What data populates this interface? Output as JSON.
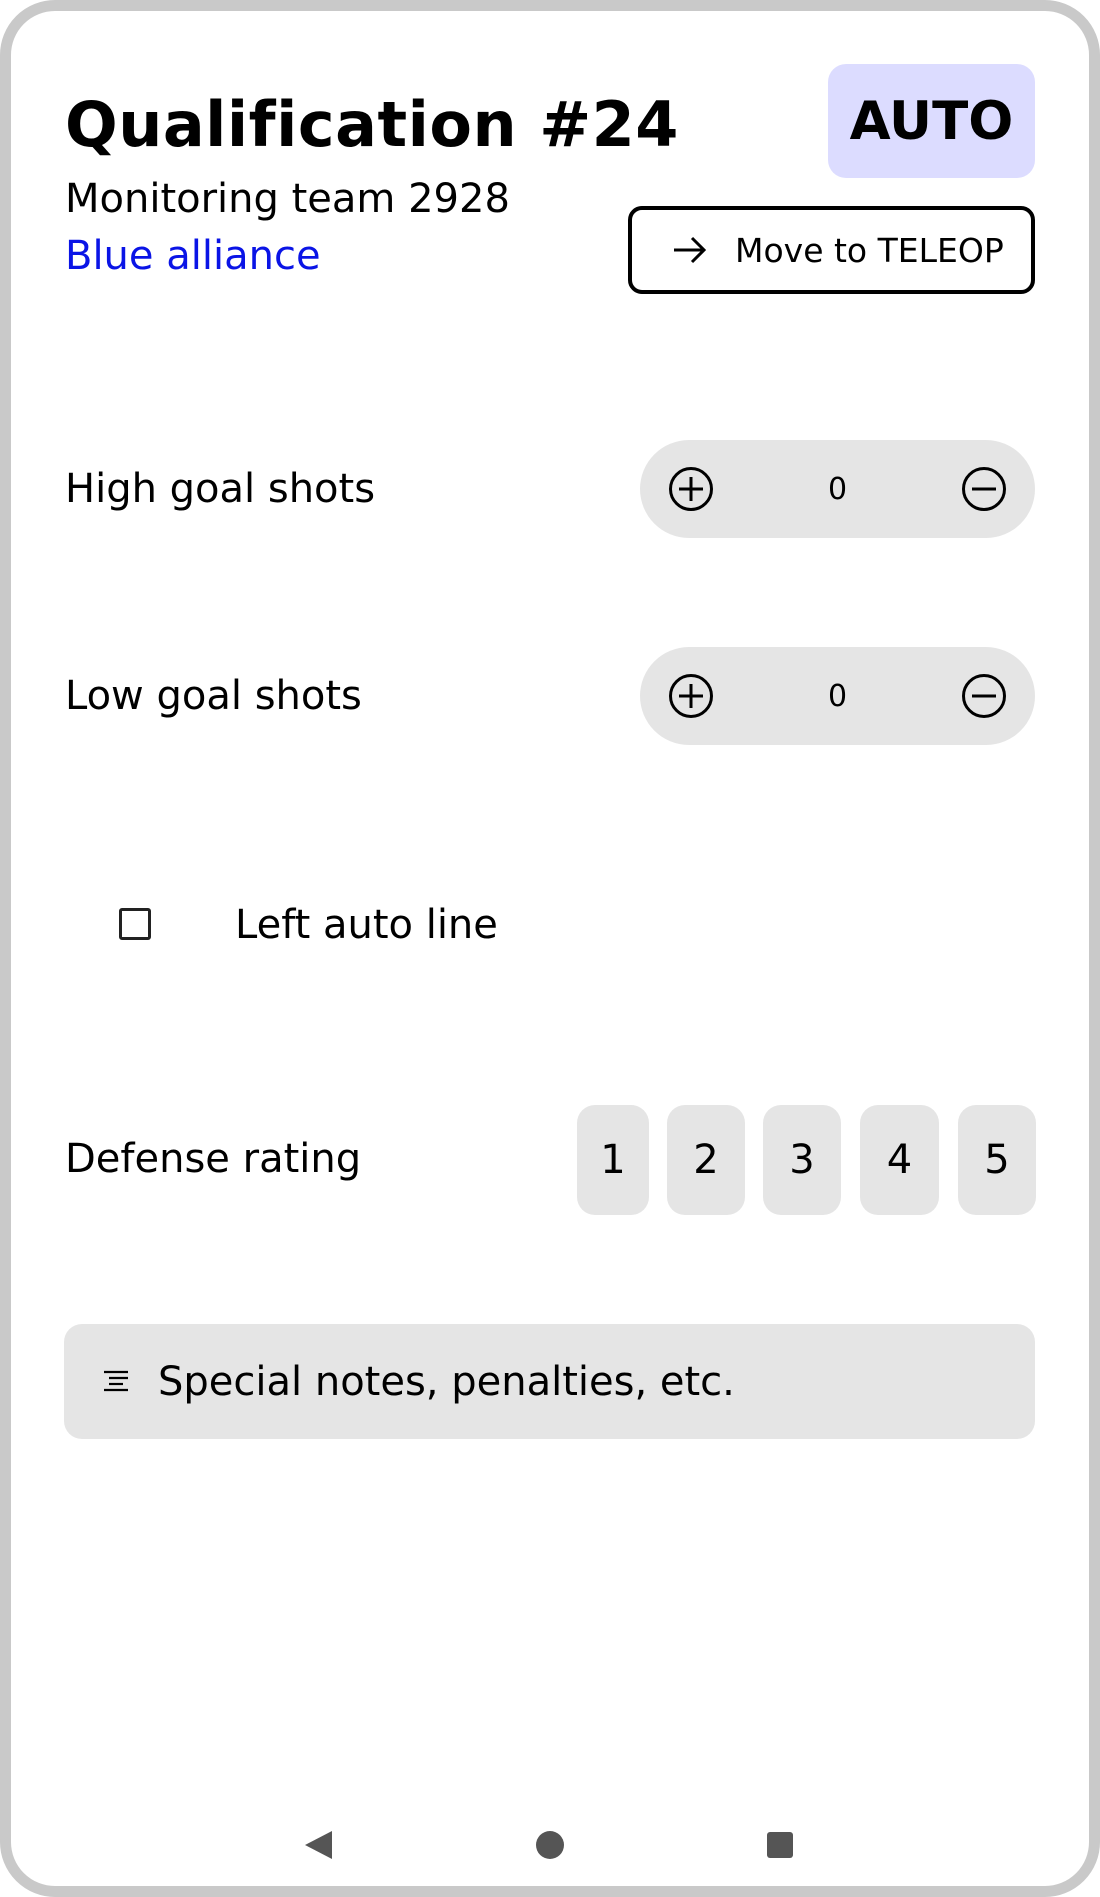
{
  "match": {
    "title": "Qualification #24",
    "team_line": "Monitoring team 2928",
    "alliance": "Blue alliance"
  },
  "mode": {
    "badge": "AUTO",
    "move_button_label": "Move to TELEOP"
  },
  "counters": [
    {
      "label": "High goal shots",
      "value": "0"
    },
    {
      "label": "Low goal shots",
      "value": "0"
    }
  ],
  "left_auto_line": {
    "label": "Left auto line",
    "checked": false
  },
  "defense": {
    "label": "Defense rating",
    "options": [
      "1",
      "2",
      "3",
      "4",
      "5"
    ]
  },
  "notes": {
    "placeholder": "Special notes, penalties, etc."
  },
  "colors": {
    "alliance": "#0a14e6",
    "badge_bg": "#dcdcff",
    "control_bg": "#e5e5e5",
    "frame": "#c9c9c9"
  },
  "icons": {
    "move": "arrow-right-icon",
    "increment": "plus-circle-icon",
    "decrement": "minus-circle-icon",
    "notes": "text-lines-icon",
    "nav_back": "triangle-back-icon",
    "nav_home": "circle-home-icon",
    "nav_recents": "square-recents-icon"
  }
}
